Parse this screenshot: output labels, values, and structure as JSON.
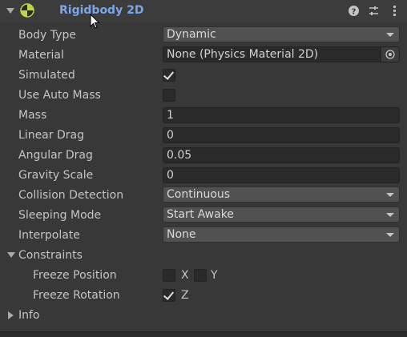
{
  "component": {
    "title": "Rigidbody 2D",
    "icon": "rigidbody-2d-icon",
    "header_icons": [
      "help-icon",
      "presets-icon",
      "kebab-menu-icon"
    ]
  },
  "properties": {
    "body_type": {
      "label": "Body Type",
      "value": "Dynamic"
    },
    "material": {
      "label": "Material",
      "value": "None (Physics Material 2D)"
    },
    "simulated": {
      "label": "Simulated",
      "checked": true
    },
    "use_auto_mass": {
      "label": "Use Auto Mass",
      "checked": false
    },
    "mass": {
      "label": "Mass",
      "value": "1"
    },
    "linear_drag": {
      "label": "Linear Drag",
      "value": "0"
    },
    "angular_drag": {
      "label": "Angular Drag",
      "value": "0.05"
    },
    "gravity_scale": {
      "label": "Gravity Scale",
      "value": "0"
    },
    "collision_detection": {
      "label": "Collision Detection",
      "value": "Continuous"
    },
    "sleeping_mode": {
      "label": "Sleeping Mode",
      "value": "Start Awake"
    },
    "interpolate": {
      "label": "Interpolate",
      "value": "None"
    }
  },
  "constraints": {
    "label": "Constraints",
    "expanded": true,
    "freeze_position": {
      "label": "Freeze Position",
      "x_label": "X",
      "y_label": "Y",
      "x_checked": false,
      "y_checked": false
    },
    "freeze_rotation": {
      "label": "Freeze Rotation",
      "z_label": "Z",
      "z_checked": true
    }
  },
  "info": {
    "label": "Info",
    "expanded": false
  },
  "colors": {
    "background": "#383838",
    "title": "#7aa7e8",
    "field": "#2a2a2a",
    "dropdown": "#515151"
  }
}
